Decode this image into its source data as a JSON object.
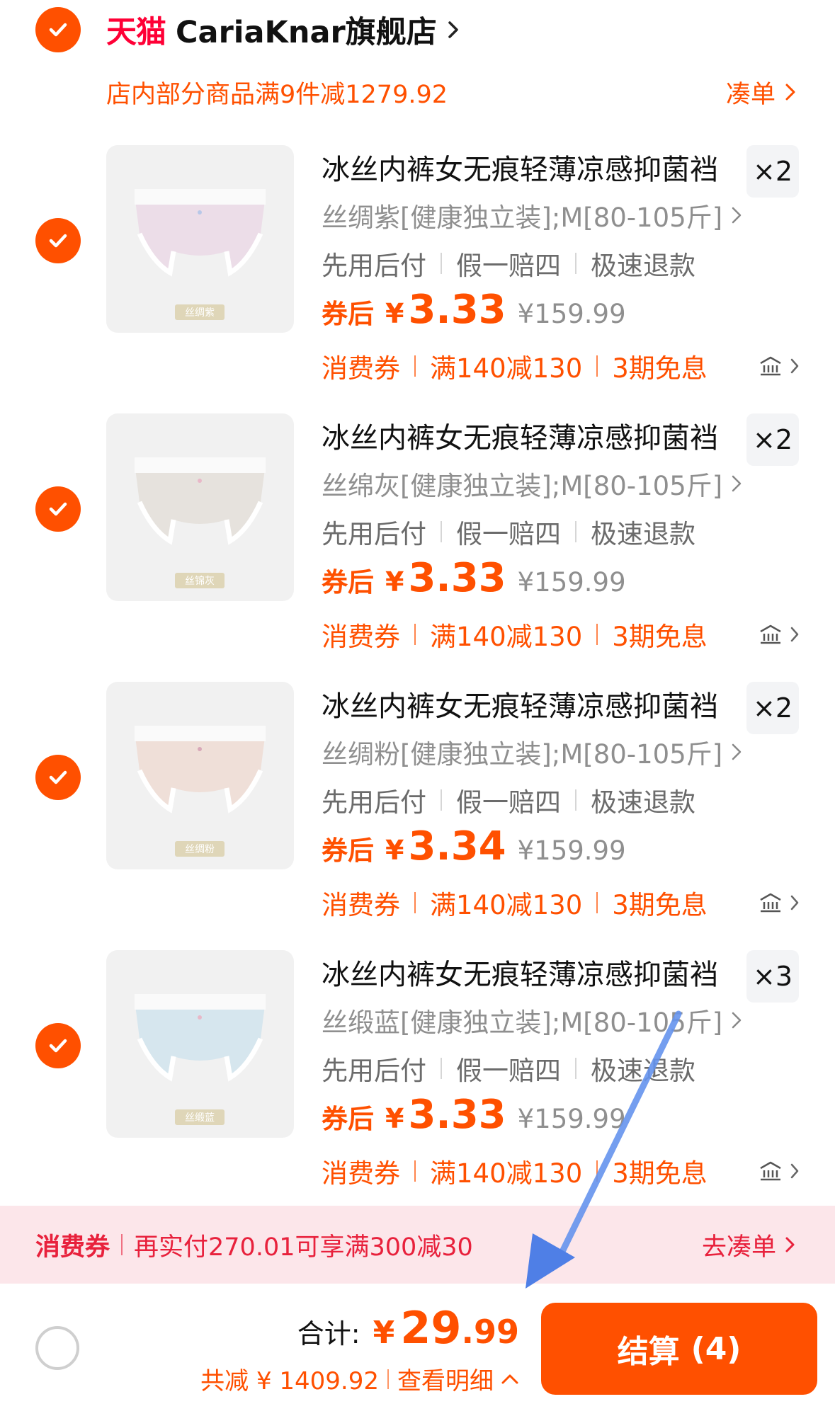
{
  "colors": {
    "accent": "#FF5000",
    "tmall": "#FF0036",
    "banner_bg": "#FCE6EA",
    "banner_text": "#E8213C",
    "annotation_arrow": "#5B8DEF"
  },
  "store": {
    "logo": "天猫",
    "name": "CariaKnar旗舰店",
    "promo_text": "店内部分商品满9件减1279.92",
    "promo_link": "凑单"
  },
  "items": [
    {
      "title": "冰丝内裤女无痕轻薄凉感抑菌裆",
      "quantity": "×2",
      "sku": "丝绸紫[健康独立装];M[80-105斤]",
      "services": [
        "先用后付",
        "假一赔四",
        "极速退款"
      ],
      "price_label": "券后",
      "currency": "¥",
      "price": "3.33",
      "original_price": "¥159.99",
      "coupons": [
        "消费券",
        "满140减130",
        "3期免息"
      ],
      "image_tag": "丝绸紫",
      "image_color": "#ecdde8"
    },
    {
      "title": "冰丝内裤女无痕轻薄凉感抑菌裆",
      "quantity": "×2",
      "sku": "丝绵灰[健康独立装];M[80-105斤]",
      "services": [
        "先用后付",
        "假一赔四",
        "极速退款"
      ],
      "price_label": "券后",
      "currency": "¥",
      "price": "3.33",
      "original_price": "¥159.99",
      "coupons": [
        "消费券",
        "满140减130",
        "3期免息"
      ],
      "image_tag": "丝锦灰",
      "image_color": "#e6e2dd"
    },
    {
      "title": "冰丝内裤女无痕轻薄凉感抑菌裆",
      "quantity": "×2",
      "sku": "丝绸粉[健康独立装];M[80-105斤]",
      "services": [
        "先用后付",
        "假一赔四",
        "极速退款"
      ],
      "price_label": "券后",
      "currency": "¥",
      "price": "3.34",
      "original_price": "¥159.99",
      "coupons": [
        "消费券",
        "满140减130",
        "3期免息"
      ],
      "image_tag": "丝绸粉",
      "image_color": "#efdfd8"
    },
    {
      "title": "冰丝内裤女无痕轻薄凉感抑菌裆",
      "quantity": "×3",
      "sku": "丝缎蓝[健康独立装];M[80-105斤]",
      "services": [
        "先用后付",
        "假一赔四",
        "极速退款"
      ],
      "price_label": "券后",
      "currency": "¥",
      "price": "3.33",
      "original_price": "¥159.99",
      "coupons": [
        "消费券",
        "满140减130",
        "3期免息"
      ],
      "image_tag": "丝缎蓝",
      "image_color": "#d6e6ee"
    }
  ],
  "banner": {
    "label": "消费券",
    "text": "再实付270.01可享满300减30",
    "link": "去凑单"
  },
  "footer": {
    "total_label": "合计:",
    "currency": "¥",
    "total_int": "29",
    "total_dec": ".99",
    "saved_text": "共减 ¥ 1409.92",
    "detail_link": "查看明细",
    "checkout_label": "结算",
    "checkout_count": "(4)"
  }
}
